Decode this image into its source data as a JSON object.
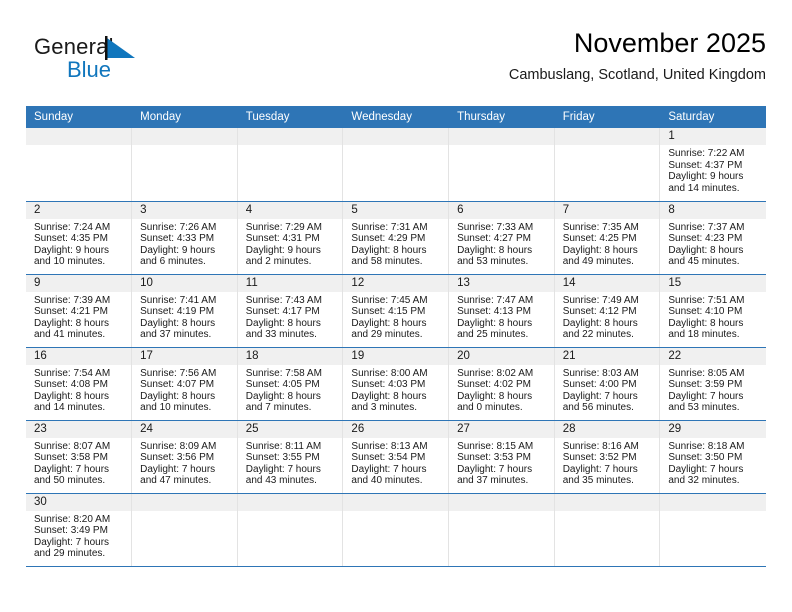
{
  "brand": {
    "name_top": "General",
    "name_bottom": "Blue",
    "flag_icon": "blue-triangle-flag-icon",
    "accent_color": "#1076bd"
  },
  "header": {
    "title": "November 2025",
    "subtitle": "Cambuslang, Scotland, United Kingdom"
  },
  "colors": {
    "header_blue": "#2e75b6",
    "daynum_band": "#f0f0f0",
    "cell_border": "#e3e3e3"
  },
  "calendar": {
    "weekday_headers": [
      "Sunday",
      "Monday",
      "Tuesday",
      "Wednesday",
      "Thursday",
      "Friday",
      "Saturday"
    ],
    "weeks": [
      [
        {
          "day": "",
          "lines": []
        },
        {
          "day": "",
          "lines": []
        },
        {
          "day": "",
          "lines": []
        },
        {
          "day": "",
          "lines": []
        },
        {
          "day": "",
          "lines": []
        },
        {
          "day": "",
          "lines": []
        },
        {
          "day": "1",
          "lines": [
            "Sunrise: 7:22 AM",
            "Sunset: 4:37 PM",
            "Daylight: 9 hours",
            "and 14 minutes."
          ]
        }
      ],
      [
        {
          "day": "2",
          "lines": [
            "Sunrise: 7:24 AM",
            "Sunset: 4:35 PM",
            "Daylight: 9 hours",
            "and 10 minutes."
          ]
        },
        {
          "day": "3",
          "lines": [
            "Sunrise: 7:26 AM",
            "Sunset: 4:33 PM",
            "Daylight: 9 hours",
            "and 6 minutes."
          ]
        },
        {
          "day": "4",
          "lines": [
            "Sunrise: 7:29 AM",
            "Sunset: 4:31 PM",
            "Daylight: 9 hours",
            "and 2 minutes."
          ]
        },
        {
          "day": "5",
          "lines": [
            "Sunrise: 7:31 AM",
            "Sunset: 4:29 PM",
            "Daylight: 8 hours",
            "and 58 minutes."
          ]
        },
        {
          "day": "6",
          "lines": [
            "Sunrise: 7:33 AM",
            "Sunset: 4:27 PM",
            "Daylight: 8 hours",
            "and 53 minutes."
          ]
        },
        {
          "day": "7",
          "lines": [
            "Sunrise: 7:35 AM",
            "Sunset: 4:25 PM",
            "Daylight: 8 hours",
            "and 49 minutes."
          ]
        },
        {
          "day": "8",
          "lines": [
            "Sunrise: 7:37 AM",
            "Sunset: 4:23 PM",
            "Daylight: 8 hours",
            "and 45 minutes."
          ]
        }
      ],
      [
        {
          "day": "9",
          "lines": [
            "Sunrise: 7:39 AM",
            "Sunset: 4:21 PM",
            "Daylight: 8 hours",
            "and 41 minutes."
          ]
        },
        {
          "day": "10",
          "lines": [
            "Sunrise: 7:41 AM",
            "Sunset: 4:19 PM",
            "Daylight: 8 hours",
            "and 37 minutes."
          ]
        },
        {
          "day": "11",
          "lines": [
            "Sunrise: 7:43 AM",
            "Sunset: 4:17 PM",
            "Daylight: 8 hours",
            "and 33 minutes."
          ]
        },
        {
          "day": "12",
          "lines": [
            "Sunrise: 7:45 AM",
            "Sunset: 4:15 PM",
            "Daylight: 8 hours",
            "and 29 minutes."
          ]
        },
        {
          "day": "13",
          "lines": [
            "Sunrise: 7:47 AM",
            "Sunset: 4:13 PM",
            "Daylight: 8 hours",
            "and 25 minutes."
          ]
        },
        {
          "day": "14",
          "lines": [
            "Sunrise: 7:49 AM",
            "Sunset: 4:12 PM",
            "Daylight: 8 hours",
            "and 22 minutes."
          ]
        },
        {
          "day": "15",
          "lines": [
            "Sunrise: 7:51 AM",
            "Sunset: 4:10 PM",
            "Daylight: 8 hours",
            "and 18 minutes."
          ]
        }
      ],
      [
        {
          "day": "16",
          "lines": [
            "Sunrise: 7:54 AM",
            "Sunset: 4:08 PM",
            "Daylight: 8 hours",
            "and 14 minutes."
          ]
        },
        {
          "day": "17",
          "lines": [
            "Sunrise: 7:56 AM",
            "Sunset: 4:07 PM",
            "Daylight: 8 hours",
            "and 10 minutes."
          ]
        },
        {
          "day": "18",
          "lines": [
            "Sunrise: 7:58 AM",
            "Sunset: 4:05 PM",
            "Daylight: 8 hours",
            "and 7 minutes."
          ]
        },
        {
          "day": "19",
          "lines": [
            "Sunrise: 8:00 AM",
            "Sunset: 4:03 PM",
            "Daylight: 8 hours",
            "and 3 minutes."
          ]
        },
        {
          "day": "20",
          "lines": [
            "Sunrise: 8:02 AM",
            "Sunset: 4:02 PM",
            "Daylight: 8 hours",
            "and 0 minutes."
          ]
        },
        {
          "day": "21",
          "lines": [
            "Sunrise: 8:03 AM",
            "Sunset: 4:00 PM",
            "Daylight: 7 hours",
            "and 56 minutes."
          ]
        },
        {
          "day": "22",
          "lines": [
            "Sunrise: 8:05 AM",
            "Sunset: 3:59 PM",
            "Daylight: 7 hours",
            "and 53 minutes."
          ]
        }
      ],
      [
        {
          "day": "23",
          "lines": [
            "Sunrise: 8:07 AM",
            "Sunset: 3:58 PM",
            "Daylight: 7 hours",
            "and 50 minutes."
          ]
        },
        {
          "day": "24",
          "lines": [
            "Sunrise: 8:09 AM",
            "Sunset: 3:56 PM",
            "Daylight: 7 hours",
            "and 47 minutes."
          ]
        },
        {
          "day": "25",
          "lines": [
            "Sunrise: 8:11 AM",
            "Sunset: 3:55 PM",
            "Daylight: 7 hours",
            "and 43 minutes."
          ]
        },
        {
          "day": "26",
          "lines": [
            "Sunrise: 8:13 AM",
            "Sunset: 3:54 PM",
            "Daylight: 7 hours",
            "and 40 minutes."
          ]
        },
        {
          "day": "27",
          "lines": [
            "Sunrise: 8:15 AM",
            "Sunset: 3:53 PM",
            "Daylight: 7 hours",
            "and 37 minutes."
          ]
        },
        {
          "day": "28",
          "lines": [
            "Sunrise: 8:16 AM",
            "Sunset: 3:52 PM",
            "Daylight: 7 hours",
            "and 35 minutes."
          ]
        },
        {
          "day": "29",
          "lines": [
            "Sunrise: 8:18 AM",
            "Sunset: 3:50 PM",
            "Daylight: 7 hours",
            "and 32 minutes."
          ]
        }
      ],
      [
        {
          "day": "30",
          "lines": [
            "Sunrise: 8:20 AM",
            "Sunset: 3:49 PM",
            "Daylight: 7 hours",
            "and 29 minutes."
          ]
        },
        {
          "day": "",
          "lines": []
        },
        {
          "day": "",
          "lines": []
        },
        {
          "day": "",
          "lines": []
        },
        {
          "day": "",
          "lines": []
        },
        {
          "day": "",
          "lines": []
        },
        {
          "day": "",
          "lines": []
        }
      ]
    ]
  }
}
